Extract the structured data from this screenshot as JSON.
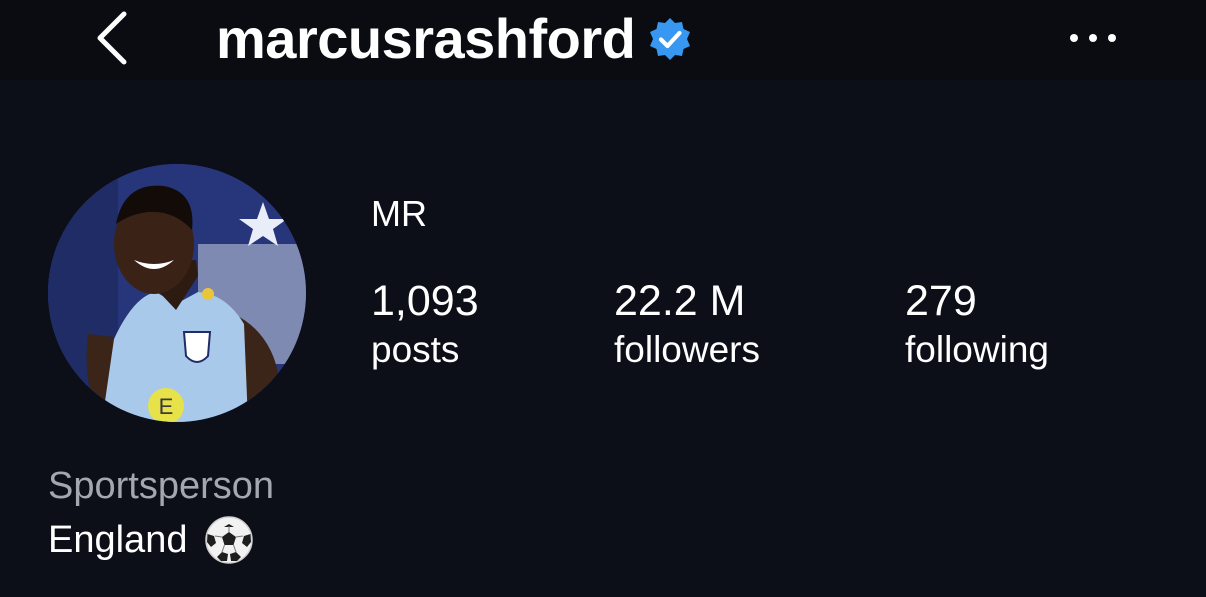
{
  "header": {
    "back_icon": "chevron-left-icon",
    "username": "marcusrashford",
    "verified_icon": "verified-badge-icon",
    "more_icon": "more-horizontal-icon",
    "verified_color": "#3897f0"
  },
  "profile": {
    "display_name": "MR",
    "stats": {
      "posts": {
        "count": "1,093",
        "label": "posts"
      },
      "followers": {
        "count": "22.2 M",
        "label": "followers"
      },
      "following": {
        "count": "279",
        "label": "following"
      }
    },
    "category": "Sportsperson",
    "bio": "England",
    "bio_icon": "soccer-ball-icon"
  },
  "colors": {
    "background": "#0c0f17",
    "header_background": "#0a0c12",
    "text": "#ffffff",
    "muted_text": "#a3a7b0"
  }
}
